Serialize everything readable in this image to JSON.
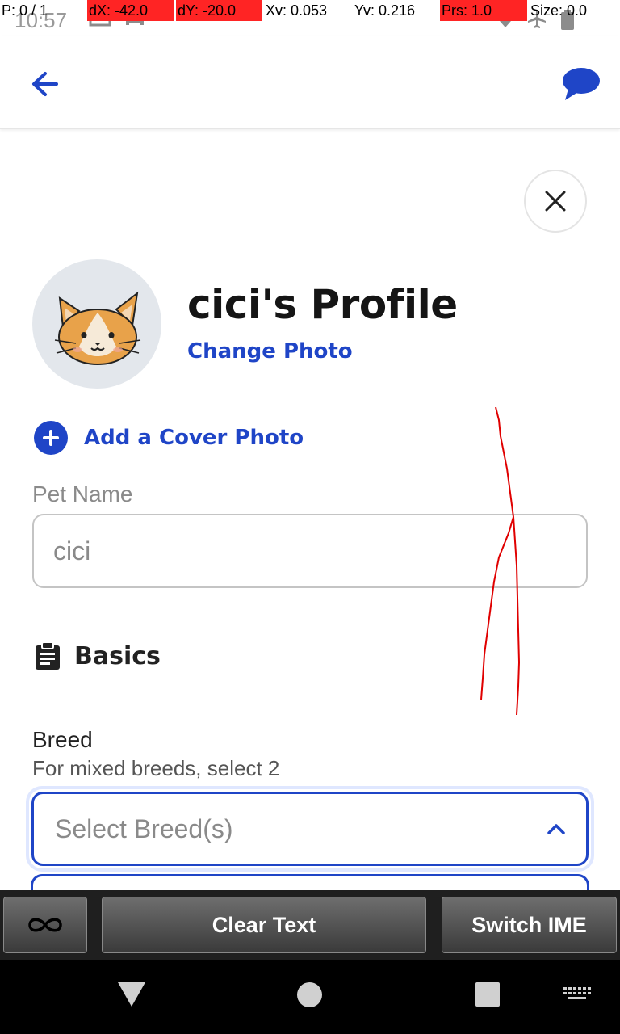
{
  "status_bar": {
    "time": "10:57",
    "debug": {
      "p": "P: 0 / 1",
      "dx": "dX: -42.0",
      "dy": "dY: -20.0",
      "xv": "Xv: 0.053",
      "yv": "Yv: 0.216",
      "prs": "Prs: 1.0",
      "size": "Size: 0.0"
    },
    "highlight_color": "#ff2424"
  },
  "app_bar": {
    "back_icon": "arrow-left-icon",
    "chat_icon": "chat-bubble-icon"
  },
  "profile": {
    "title": "cici's Profile",
    "change_photo": "Change Photo",
    "avatar_icon": "cat-face-icon",
    "close_icon": "close-icon"
  },
  "cover": {
    "label": "Add a Cover Photo",
    "icon": "plus-circle-icon"
  },
  "pet_name": {
    "label": "Pet Name",
    "value": "cici"
  },
  "basics": {
    "label": "Basics",
    "icon": "clipboard-icon"
  },
  "breed": {
    "label": "Breed",
    "hint": "For mixed breeds, select 2",
    "placeholder": "Select Breed(s)",
    "icon": "chevron-up-icon"
  },
  "ime": {
    "clear_text": "Clear Text",
    "switch_ime": "Switch IME",
    "infinity_icon": "infinity-icon"
  },
  "colors": {
    "accent": "#1f45c7",
    "title": "#151515",
    "muted": "#8a8a8a",
    "trace": "#e00000"
  }
}
